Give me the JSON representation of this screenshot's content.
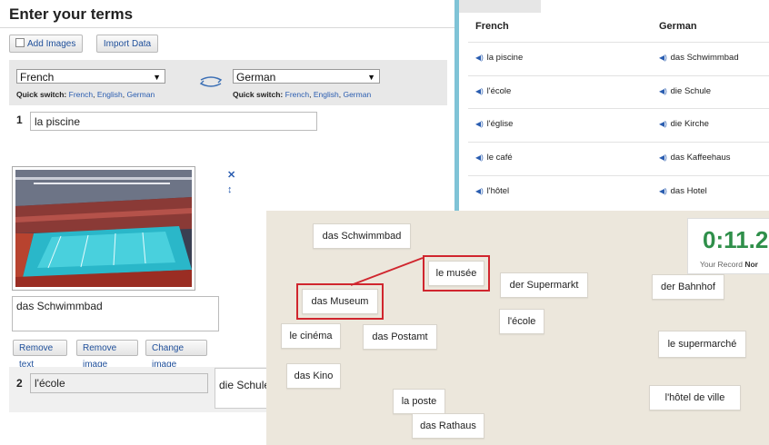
{
  "editor": {
    "title": "Enter your terms",
    "add_images": "Add Images",
    "import_data": "Import Data",
    "lang_left": "French",
    "lang_right": "German",
    "quick_switch_label": "Quick switch:",
    "quick_switch_links": [
      "French",
      "English",
      "German"
    ],
    "row1_number": "1",
    "row1_term": "la piscine",
    "row1_definition": "das Schwimmbad",
    "remove_text": "Remove text",
    "remove_image": "Remove image",
    "change_image": "Change image",
    "row2_number": "2",
    "row2_term": "l'école",
    "row2_definition": "die Schule"
  },
  "wordlist": {
    "col_left": "French",
    "col_right": "German",
    "rows": [
      {
        "fr": "la piscine",
        "de": "das Schwimmbad"
      },
      {
        "fr": "l'école",
        "de": "die Schule"
      },
      {
        "fr": "l'église",
        "de": "die Kirche"
      },
      {
        "fr": "le café",
        "de": "das Kaffeehaus"
      },
      {
        "fr": "l'hôtel",
        "de": "das Hotel"
      }
    ]
  },
  "game": {
    "timer": "0:11.2",
    "record_label": "Your Record",
    "record_value": "Nor",
    "cards": [
      "das Schwimmbad",
      "le musée",
      "das Museum",
      "der Supermarkt",
      "der Bahnhof",
      "l'école",
      "le cinéma",
      "das Postamt",
      "le supermarché",
      "das Kino",
      "la poste",
      "l'hôtel de ville",
      "das Rathaus"
    ]
  },
  "colors": {
    "background": "#7fc3d6",
    "link": "#2a5db0",
    "timer": "#2f8f4a",
    "highlight": "#d0262e"
  }
}
